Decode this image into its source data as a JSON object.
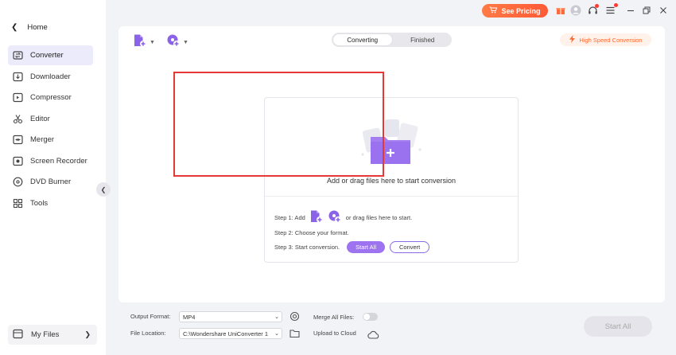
{
  "titlebar": {
    "pricing_label": "See Pricing",
    "accent": "#ff5a36"
  },
  "sidebar": {
    "home_label": "Home",
    "items": [
      {
        "label": "Converter",
        "icon": "converter-icon",
        "active": true
      },
      {
        "label": "Downloader",
        "icon": "downloader-icon"
      },
      {
        "label": "Compressor",
        "icon": "compressor-icon"
      },
      {
        "label": "Editor",
        "icon": "scissors-icon"
      },
      {
        "label": "Merger",
        "icon": "merger-icon"
      },
      {
        "label": "Screen Recorder",
        "icon": "screen-recorder-icon"
      },
      {
        "label": "DVD Burner",
        "icon": "disc-icon"
      },
      {
        "label": "Tools",
        "icon": "grid-icon"
      }
    ],
    "my_files_label": "My Files"
  },
  "main": {
    "tabs": [
      {
        "label": "Converting",
        "active": true
      },
      {
        "label": "Finished"
      }
    ],
    "high_speed_label": "High Speed Conversion",
    "drop_text": "Add or drag files here to start conversion",
    "step1_prefix": "Step 1: Add",
    "step1_suffix": "or drag files here to start.",
    "step2": "Step 2: Choose your format.",
    "step3": "Step 3: Start conversion.",
    "start_all_small": "Start All",
    "convert_label": "Convert",
    "brand_color": "#9d73f0"
  },
  "bottom": {
    "output_format_label": "Output Format:",
    "output_format_value": "MP4",
    "file_location_label": "File Location:",
    "file_location_value": "C:\\Wondershare UniConverter 1",
    "merge_label": "Merge All Files:",
    "upload_label": "Upload to Cloud",
    "start_all_label": "Start All"
  }
}
